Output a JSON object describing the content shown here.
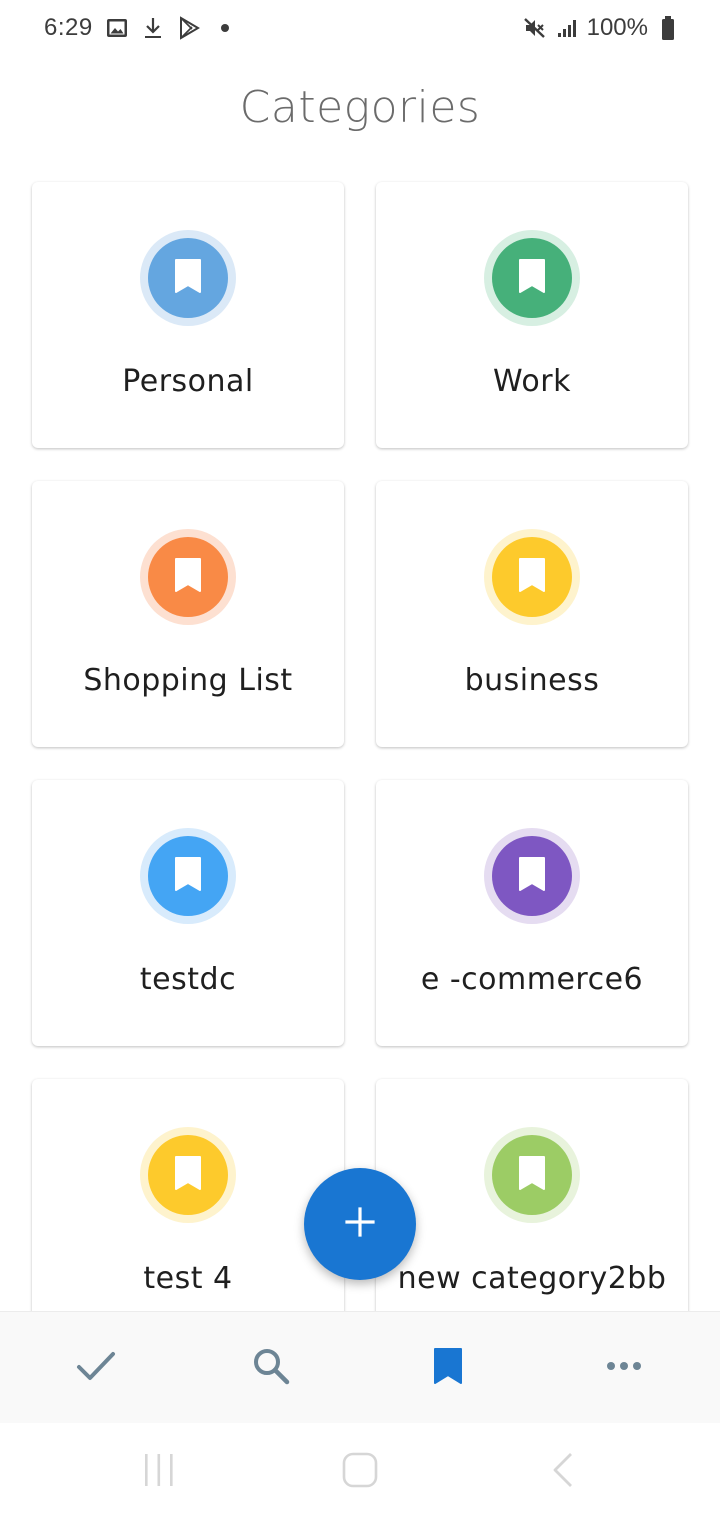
{
  "status_bar": {
    "time": "6:29",
    "battery": "100%",
    "icons": [
      "image-icon",
      "download-icon",
      "play-store-icon",
      "dot-icon",
      "mute-icon",
      "signal-icon",
      "battery-icon"
    ]
  },
  "page": {
    "title": "Categories"
  },
  "categories": [
    {
      "label": "Personal",
      "color": "#64a6e0",
      "ring": "#dbe9f7",
      "icon": "bookmark-icon"
    },
    {
      "label": "Work",
      "color": "#46b07a",
      "ring": "#d7efe2",
      "icon": "bookmark-icon"
    },
    {
      "label": "Shopping List",
      "color": "#f98a46",
      "ring": "#fde0d1",
      "icon": "bookmark-icon"
    },
    {
      "label": "business",
      "color": "#fdca2c",
      "ring": "#fef3cd",
      "icon": "bookmark-icon"
    },
    {
      "label": "testdc",
      "color": "#44a5f4",
      "ring": "#d8ebfc",
      "icon": "bookmark-icon"
    },
    {
      "label": "e -commerce6",
      "color": "#7e57c2",
      "ring": "#e5dcf1",
      "icon": "bookmark-icon"
    },
    {
      "label": "test 4",
      "color": "#fdca2c",
      "ring": "#fef3cd",
      "icon": "bookmark-icon"
    },
    {
      "label": "new category2bb",
      "color": "#9ccc65",
      "ring": "#e8f3dc",
      "icon": "bookmark-icon"
    }
  ],
  "fab": {
    "icon": "plus-icon",
    "color": "#1976d2"
  },
  "bottom_nav": {
    "items": [
      {
        "name": "tasks",
        "icon": "check-icon",
        "active": false
      },
      {
        "name": "search",
        "icon": "search-icon",
        "active": false
      },
      {
        "name": "categories",
        "icon": "bookmark-icon",
        "active": true
      },
      {
        "name": "more",
        "icon": "more-icon",
        "active": false
      }
    ],
    "active_color": "#1976d2",
    "inactive_color": "#6d8595"
  },
  "system_nav": {
    "icons": [
      "recent-apps-icon",
      "home-icon",
      "back-icon"
    ]
  }
}
